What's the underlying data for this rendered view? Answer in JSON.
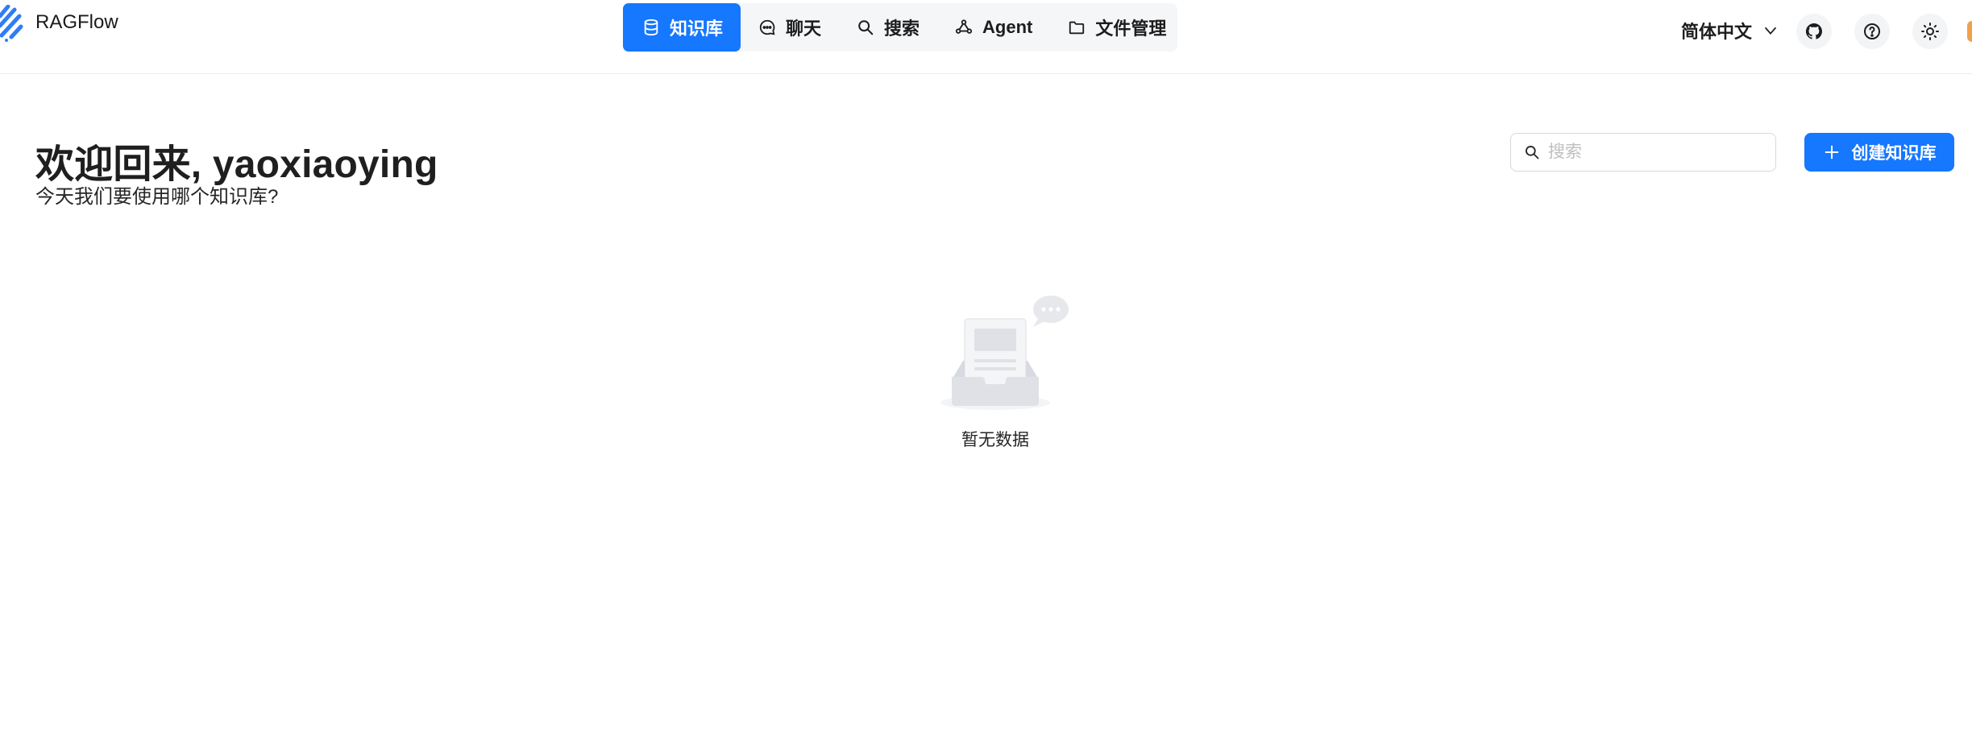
{
  "app": {
    "title": "RAGFlow",
    "accent_color": "#1677ff"
  },
  "nav": {
    "items": [
      {
        "label": "知识库",
        "icon": "database-icon",
        "active": true
      },
      {
        "label": "聊天",
        "icon": "chat-bubble-icon",
        "active": false
      },
      {
        "label": "搜索",
        "icon": "search-icon",
        "active": false
      },
      {
        "label": "Agent",
        "icon": "agent-graph-icon",
        "active": false
      },
      {
        "label": "文件管理",
        "icon": "folder-icon",
        "active": false
      }
    ]
  },
  "header_right": {
    "language": "简体中文",
    "language_icon": "chevron-down-icon",
    "buttons": [
      "github-icon",
      "help-icon",
      "theme-sun-icon"
    ]
  },
  "welcome": {
    "title": "欢迎回来, yaoxiaoying",
    "subtitle": "今天我们要使用哪个知识库?"
  },
  "search": {
    "placeholder": "搜索",
    "value": ""
  },
  "create_button": {
    "label": "创建知识库",
    "icon": "plus-icon"
  },
  "empty_state": {
    "text": "暂无数据",
    "icon": "empty-inbox-icon"
  }
}
